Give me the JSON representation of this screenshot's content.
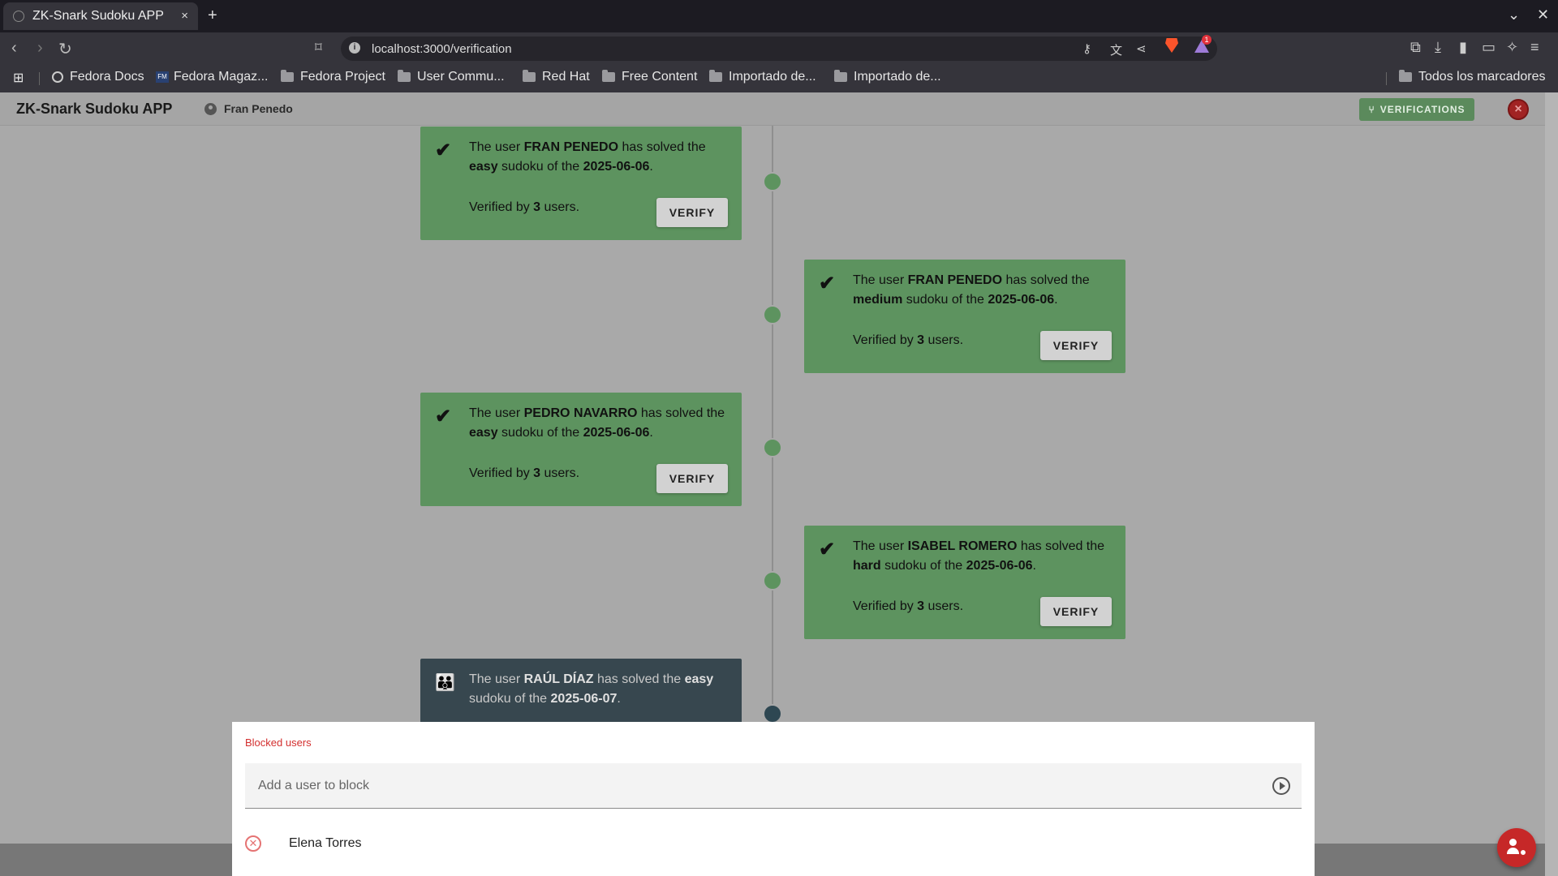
{
  "browser": {
    "tab_title": "ZK-Snark Sudoku APP",
    "tab_close": "×",
    "new_tab": "+",
    "url": "localhost:3000/verification",
    "bookmarks": [
      {
        "label": "Fedora Docs",
        "icon": "globe-icon"
      },
      {
        "label": "Fedora Magaz...",
        "icon": "fedora-magazine-icon"
      },
      {
        "label": "Fedora Project",
        "icon": "folder-icon"
      },
      {
        "label": "User Commu...",
        "icon": "folder-icon"
      },
      {
        "label": "Red Hat",
        "icon": "folder-icon"
      },
      {
        "label": "Free Content",
        "icon": "folder-icon"
      },
      {
        "label": "Importado de...",
        "icon": "folder-icon"
      },
      {
        "label": "Importado de...",
        "icon": "folder-icon"
      }
    ],
    "all_bookmarks": "Todos los marcadores",
    "rewards_badge": "1"
  },
  "app": {
    "title": "ZK-Snark Sudoku APP",
    "user": "Fran Penedo",
    "verifications_button": "VERIFICATIONS",
    "colors": {
      "solved": "#5d935f",
      "pending": "#37474f",
      "danger": "#c62828"
    }
  },
  "timeline": {
    "cards": [
      {
        "prefix": "The user ",
        "user": "FRAN PENEDO",
        "mid": " has solved the ",
        "difficulty": "easy",
        "mid2": " sudoku of the ",
        "date": "2025-06-06",
        "end": ".",
        "verified_prefix": "Verified by ",
        "verified_count": "3",
        "verified_suffix": " users.",
        "button": "VERIFY"
      },
      {
        "prefix": "The user ",
        "user": "FRAN PENEDO",
        "mid": " has solved the ",
        "difficulty": "medium",
        "mid2": " sudoku of the ",
        "date": "2025-06-06",
        "end": ".",
        "verified_prefix": "Verified by ",
        "verified_count": "3",
        "verified_suffix": " users.",
        "button": "VERIFY"
      },
      {
        "prefix": "The user ",
        "user": "PEDRO NAVARRO",
        "mid": " has solved the ",
        "difficulty": "easy",
        "mid2": " sudoku of the ",
        "date": "2025-06-06",
        "end": ".",
        "verified_prefix": "Verified by ",
        "verified_count": "3",
        "verified_suffix": " users.",
        "button": "VERIFY"
      },
      {
        "prefix": "The user ",
        "user": "ISABEL ROMERO",
        "mid": " has solved the ",
        "difficulty": "hard",
        "mid2": " sudoku of the ",
        "date": "2025-06-06",
        "end": ".",
        "verified_prefix": "Verified by ",
        "verified_count": "3",
        "verified_suffix": " users.",
        "button": "VERIFY"
      },
      {
        "prefix": "The user ",
        "user": "RAÚL DÍAZ",
        "mid": " has solved the ",
        "difficulty": "easy",
        "mid2": " sudoku of the ",
        "date": "2025-06-07",
        "end": "."
      }
    ]
  },
  "blocked": {
    "title": "Blocked users",
    "placeholder": "Add a user to block",
    "users": [
      "Elena Torres"
    ]
  }
}
